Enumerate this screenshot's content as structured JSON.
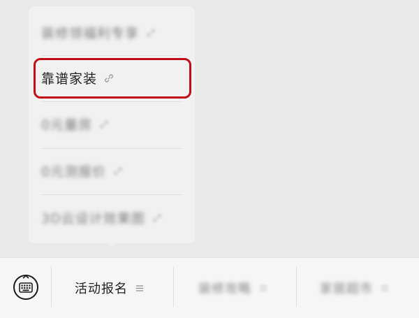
{
  "popup_menu": {
    "items": [
      {
        "label": "装修领福利专享"
      },
      {
        "label": "靠谱家装"
      },
      {
        "label": "0元量房"
      },
      {
        "label": "0元测报价"
      },
      {
        "label": "3D云设计效果图"
      }
    ]
  },
  "bottom_bar": {
    "items": [
      {
        "label": "活动报名"
      },
      {
        "label": "装修攻略"
      },
      {
        "label": "家居超市"
      }
    ]
  },
  "colors": {
    "highlight_border": "#c00d18",
    "popup_background": "#f1f1f1",
    "page_background": "#e9e9e9"
  }
}
